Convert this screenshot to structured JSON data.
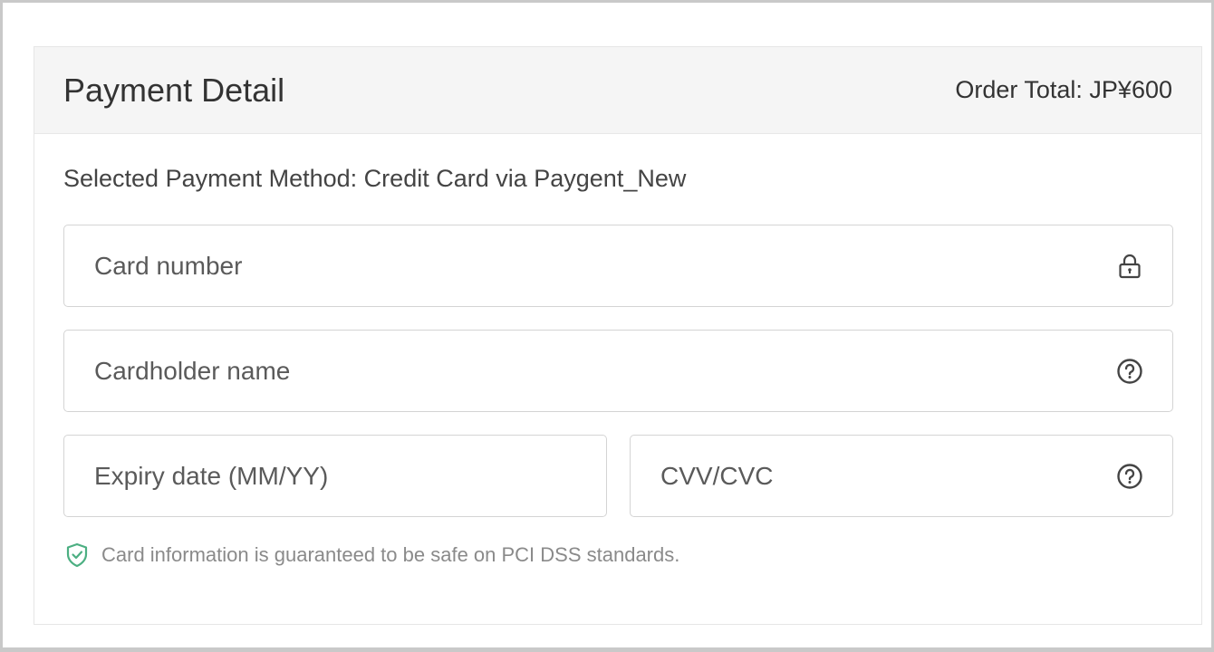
{
  "header": {
    "title": "Payment Detail",
    "order_total": "Order Total: JP¥600"
  },
  "body": {
    "payment_method": "Selected Payment Method: Credit Card via Paygent_New",
    "fields": {
      "card_number": {
        "placeholder": "Card number",
        "icon": "lock-icon"
      },
      "cardholder_name": {
        "placeholder": "Cardholder name",
        "icon": "help-icon"
      },
      "expiry_date": {
        "placeholder": "Expiry date (MM/YY)"
      },
      "cvv": {
        "placeholder": "CVV/CVC",
        "icon": "help-icon"
      }
    },
    "security_notice": {
      "text": "Card information is guaranteed to be safe on PCI DSS standards.",
      "icon": "shield-check-icon"
    }
  },
  "colors": {
    "header_bg": "#f5f5f5",
    "border": "#d4d4d4",
    "shield_green": "#4caf82"
  }
}
